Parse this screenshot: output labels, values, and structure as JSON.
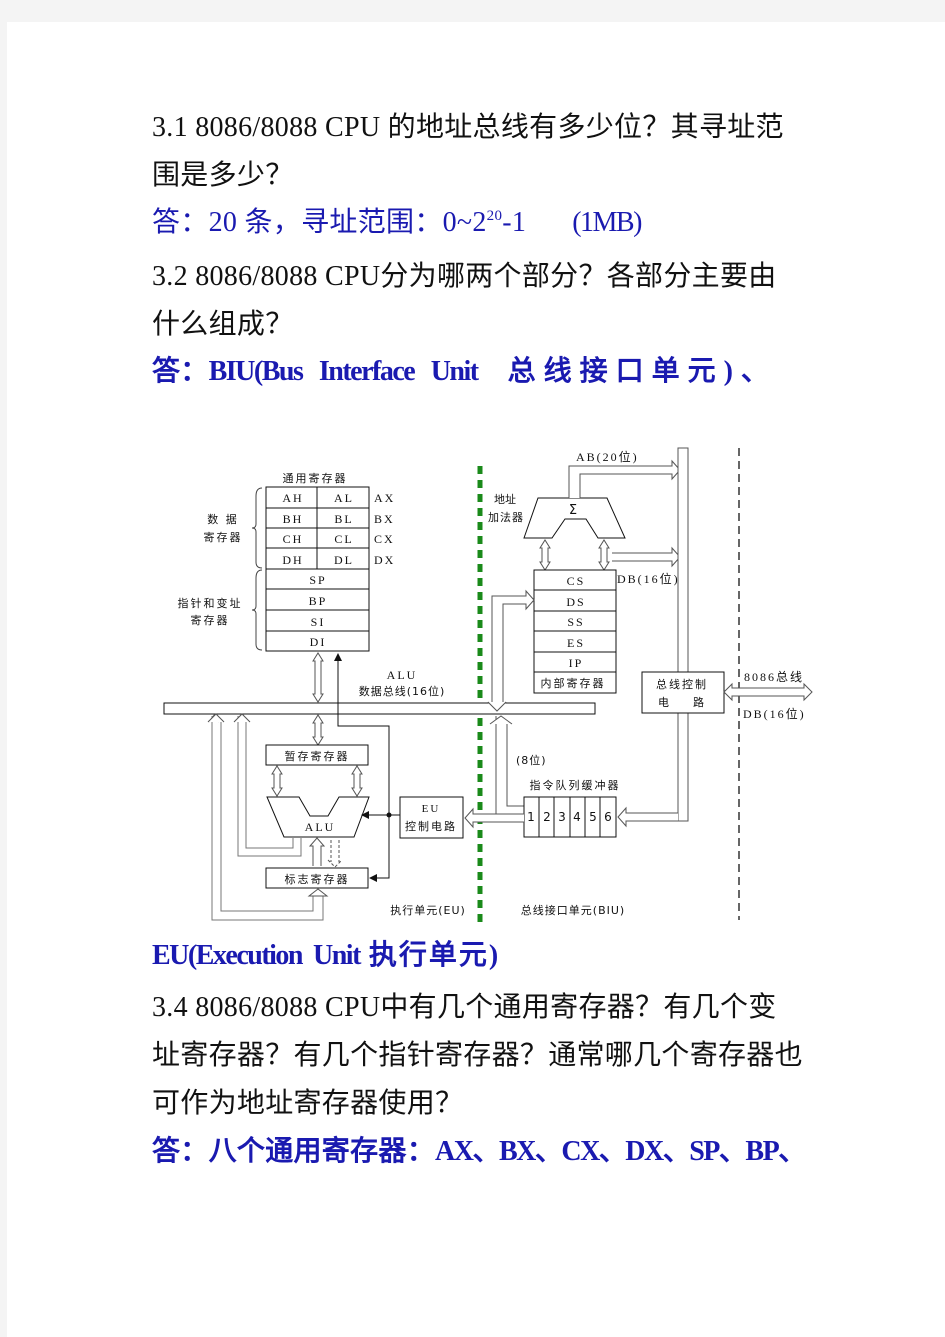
{
  "q31": {
    "line1": "3.1  8086/8088  CPU 的地址总线有多少位？其寻址范",
    "line2": "围是多少？",
    "answer_prefix": "答：20 条，寻址范围：0~2",
    "answer_exp": "20",
    "answer_suffix": "-1",
    "answer_note": "(1MB)"
  },
  "q32": {
    "line1": "3.2    8086/8088  CPU分为哪两个部分？各部分主要由",
    "line2": "什么组成？",
    "answer_prefix": "答：",
    "answer_biu": "BIU(Bus   Interface   Unit",
    "answer_biu_cn": "  总线接口单元)、",
    "answer_eu": "EU(Execution  Unit",
    "answer_eu_cn": " 执行单元)"
  },
  "diagram": {
    "gp_reg_title": "通用寄存器",
    "data_reg_label": [
      "数    据",
      "寄存器"
    ],
    "ptr_reg_label": [
      "指针和变址",
      "寄存器"
    ],
    "byte_regs": [
      {
        "hi": "AH",
        "lo": "AL",
        "word": "AX"
      },
      {
        "hi": "BH",
        "lo": "BL",
        "word": "BX"
      },
      {
        "hi": "CH",
        "lo": "CL",
        "word": "CX"
      },
      {
        "hi": "DH",
        "lo": "DL",
        "word": "DX"
      }
    ],
    "ptr_regs": [
      "SP",
      "BP",
      "SI",
      "DI"
    ],
    "alu_bus_label": [
      "ALU",
      "数据总线(16位)"
    ],
    "temp_reg": "暂存寄存器",
    "alu": "ALU",
    "flag_reg": "标志寄存器",
    "eu_ctrl": [
      "EU",
      "控制电路"
    ],
    "eu_label": "执行单元(EU)",
    "biu_label": "总线接口单元(BIU)",
    "adder_label": [
      "地址",
      "加法器"
    ],
    "sigma": "Σ",
    "ab_label": "AB(20位)",
    "db_label": "DB(16位)",
    "seg_regs": [
      "CS",
      "DS",
      "SS",
      "ES",
      "IP"
    ],
    "internal_regs": "内部寄存器",
    "bus_ctrl": [
      "总线控制",
      "电    路"
    ],
    "ext_bus": "8086总线",
    "ext_db": "DB(16位)",
    "queue_title": "指令队列缓冲器",
    "queue_width": "(8位)",
    "queue_slots": [
      "1",
      "2",
      "3",
      "4",
      "5",
      "6"
    ],
    "divider_color": "#1a8a1a"
  },
  "q34": {
    "line1": "3.4    8086/8088  CPU中有几个通用寄存器？有几个变",
    "line2": "址寄存器？有几个指针寄存器？通常哪几个寄存器也",
    "line3": "可作为地址寄存器使用？",
    "answer_prefix": "答：八个通用寄存器：",
    "answer_regs": "AX、BX、CX、DX、SP、BP、"
  }
}
